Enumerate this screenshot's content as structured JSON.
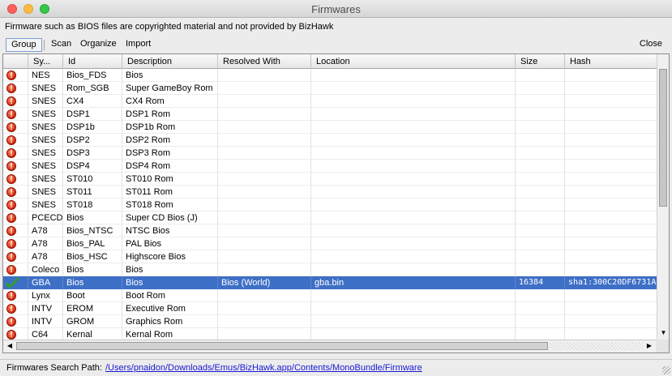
{
  "window": {
    "title": "Firmwares"
  },
  "notice": "Firmware such as BIOS files are copyrighted material and not provided by BizHawk",
  "toolbar": {
    "group_label": "Group",
    "scan_label": "Scan",
    "organize_label": "Organize",
    "import_label": "Import",
    "close_label": "Close"
  },
  "table": {
    "columns": [
      "",
      "Sy...",
      "Id",
      "Description",
      "Resolved With",
      "Location",
      "Size",
      "Hash"
    ],
    "rows": [
      {
        "status": "missing",
        "system": "NES",
        "id": "Bios_FDS",
        "description": "Bios",
        "resolved": "",
        "location": "",
        "size": "",
        "hash": ""
      },
      {
        "status": "missing",
        "system": "SNES",
        "id": "Rom_SGB",
        "description": "Super GameBoy Rom",
        "resolved": "",
        "location": "",
        "size": "",
        "hash": ""
      },
      {
        "status": "missing",
        "system": "SNES",
        "id": "CX4",
        "description": "CX4 Rom",
        "resolved": "",
        "location": "",
        "size": "",
        "hash": ""
      },
      {
        "status": "missing",
        "system": "SNES",
        "id": "DSP1",
        "description": "DSP1 Rom",
        "resolved": "",
        "location": "",
        "size": "",
        "hash": ""
      },
      {
        "status": "missing",
        "system": "SNES",
        "id": "DSP1b",
        "description": "DSP1b Rom",
        "resolved": "",
        "location": "",
        "size": "",
        "hash": ""
      },
      {
        "status": "missing",
        "system": "SNES",
        "id": "DSP2",
        "description": "DSP2 Rom",
        "resolved": "",
        "location": "",
        "size": "",
        "hash": ""
      },
      {
        "status": "missing",
        "system": "SNES",
        "id": "DSP3",
        "description": "DSP3 Rom",
        "resolved": "",
        "location": "",
        "size": "",
        "hash": ""
      },
      {
        "status": "missing",
        "system": "SNES",
        "id": "DSP4",
        "description": "DSP4 Rom",
        "resolved": "",
        "location": "",
        "size": "",
        "hash": ""
      },
      {
        "status": "missing",
        "system": "SNES",
        "id": "ST010",
        "description": "ST010 Rom",
        "resolved": "",
        "location": "",
        "size": "",
        "hash": ""
      },
      {
        "status": "missing",
        "system": "SNES",
        "id": "ST011",
        "description": "ST011 Rom",
        "resolved": "",
        "location": "",
        "size": "",
        "hash": ""
      },
      {
        "status": "missing",
        "system": "SNES",
        "id": "ST018",
        "description": "ST018 Rom",
        "resolved": "",
        "location": "",
        "size": "",
        "hash": ""
      },
      {
        "status": "missing",
        "system": "PCECD",
        "id": "Bios",
        "description": "Super CD Bios (J)",
        "resolved": "",
        "location": "",
        "size": "",
        "hash": ""
      },
      {
        "status": "missing",
        "system": "A78",
        "id": "Bios_NTSC",
        "description": "NTSC Bios",
        "resolved": "",
        "location": "",
        "size": "",
        "hash": ""
      },
      {
        "status": "missing",
        "system": "A78",
        "id": "Bios_PAL",
        "description": "PAL Bios",
        "resolved": "",
        "location": "",
        "size": "",
        "hash": ""
      },
      {
        "status": "missing",
        "system": "A78",
        "id": "Bios_HSC",
        "description": "Highscore Bios",
        "resolved": "",
        "location": "",
        "size": "",
        "hash": ""
      },
      {
        "status": "missing",
        "system": "Coleco",
        "id": "Bios",
        "description": "Bios",
        "resolved": "",
        "location": "",
        "size": "",
        "hash": ""
      },
      {
        "status": "ok",
        "system": "GBA",
        "id": "Bios",
        "description": "Bios",
        "resolved": "Bios (World)",
        "location": "gba.bin",
        "size": "16384",
        "hash": "sha1:300C20DF6731A"
      },
      {
        "status": "missing",
        "system": "Lynx",
        "id": "Boot",
        "description": "Boot Rom",
        "resolved": "",
        "location": "",
        "size": "",
        "hash": ""
      },
      {
        "status": "missing",
        "system": "INTV",
        "id": "EROM",
        "description": "Executive Rom",
        "resolved": "",
        "location": "",
        "size": "",
        "hash": ""
      },
      {
        "status": "missing",
        "system": "INTV",
        "id": "GROM",
        "description": "Graphics Rom",
        "resolved": "",
        "location": "",
        "size": "",
        "hash": ""
      },
      {
        "status": "missing",
        "system": "C64",
        "id": "Kernal",
        "description": "Kernal Rom",
        "resolved": "",
        "location": "",
        "size": "",
        "hash": ""
      }
    ],
    "selected_row": 16
  },
  "status": {
    "label": "Firmwares Search Path:",
    "path": "/Users/pnaidon/Downloads/Emus/BizHawk.app/Contents/MonoBundle/Firmware"
  },
  "colors": {
    "selection": "#3e6fc6",
    "missing_icon": "#d42a0c",
    "ok_icon": "#2e9e2e",
    "link": "#1a1ad4"
  },
  "icons": {
    "missing": "error-icon",
    "ok": "check-icon"
  }
}
